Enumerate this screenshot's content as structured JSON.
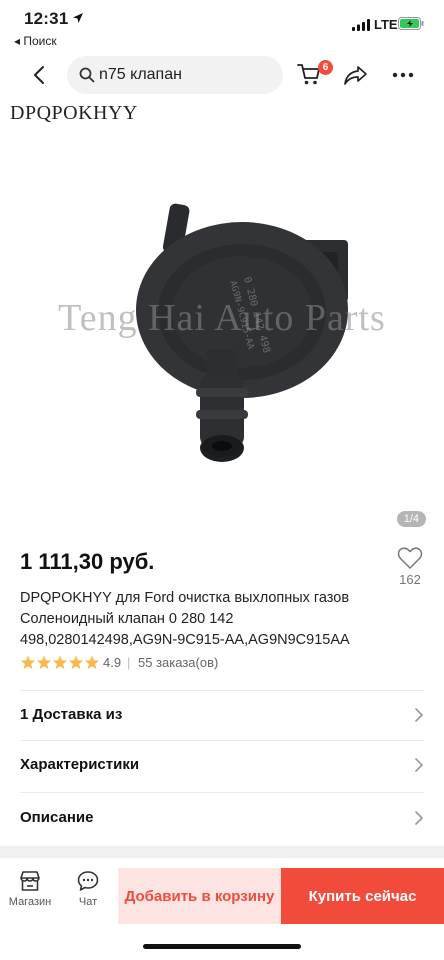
{
  "status_bar": {
    "time": "12:31",
    "back_app": "◂ Поиск",
    "network": "LTE"
  },
  "header": {
    "search_value": "n75 клапан",
    "cart_count": "6"
  },
  "gallery": {
    "brand_watermark": "DPQPOKHYY",
    "site_watermark": "Teng Hai Auto Parts",
    "counter": "1/4"
  },
  "product": {
    "price": "1 111,30 руб.",
    "wishlist_count": "162",
    "title": "DPQPOKHYY для Ford очистка выхлопных газов Соленоидный клапан 0 280 142 498,0280142498,AG9N-9C915-AA,AG9N9C915AA",
    "rating": "4.9",
    "rating_stars": 5,
    "rating_separator": "|",
    "orders": "55 заказа(ов)"
  },
  "sections": [
    {
      "label": "1 Доставка из"
    },
    {
      "label": "Характеристики"
    },
    {
      "label": "Описание"
    }
  ],
  "bottom_bar": {
    "shop_label": "Магазин",
    "chat_label": "Чат",
    "add_to_cart": "Добавить в корзину",
    "buy_now": "Купить сейчас"
  },
  "colors": {
    "accent": "#f24a3b",
    "accent_light": "#fde3e1",
    "star": "#f8b84e",
    "battery": "#34c759"
  }
}
